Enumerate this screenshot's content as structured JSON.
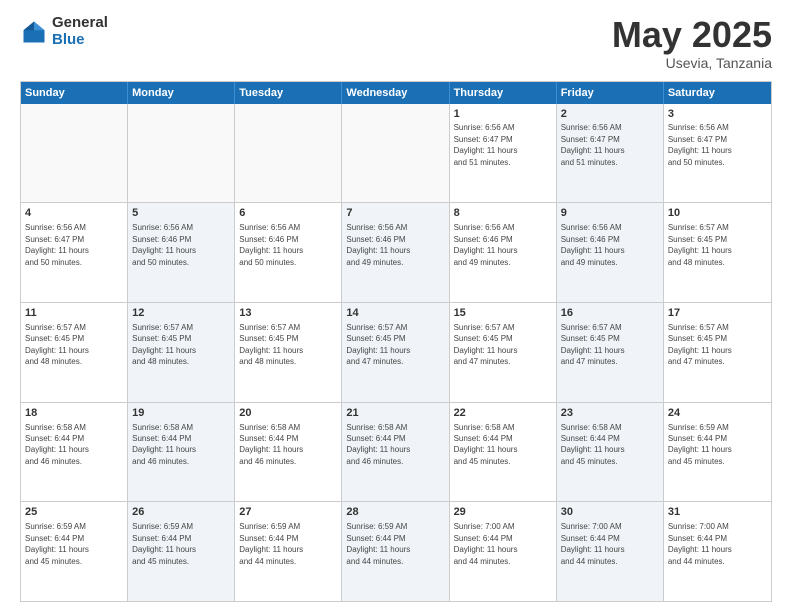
{
  "logo": {
    "general": "General",
    "blue": "Blue"
  },
  "header": {
    "month": "May 2025",
    "location": "Usevia, Tanzania"
  },
  "weekdays": [
    "Sunday",
    "Monday",
    "Tuesday",
    "Wednesday",
    "Thursday",
    "Friday",
    "Saturday"
  ],
  "rows": [
    [
      {
        "day": "",
        "info": "",
        "shaded": false,
        "empty": true
      },
      {
        "day": "",
        "info": "",
        "shaded": false,
        "empty": true
      },
      {
        "day": "",
        "info": "",
        "shaded": false,
        "empty": true
      },
      {
        "day": "",
        "info": "",
        "shaded": false,
        "empty": true
      },
      {
        "day": "1",
        "info": "Sunrise: 6:56 AM\nSunset: 6:47 PM\nDaylight: 11 hours\nand 51 minutes.",
        "shaded": false,
        "empty": false
      },
      {
        "day": "2",
        "info": "Sunrise: 6:56 AM\nSunset: 6:47 PM\nDaylight: 11 hours\nand 51 minutes.",
        "shaded": true,
        "empty": false
      },
      {
        "day": "3",
        "info": "Sunrise: 6:56 AM\nSunset: 6:47 PM\nDaylight: 11 hours\nand 50 minutes.",
        "shaded": false,
        "empty": false
      }
    ],
    [
      {
        "day": "4",
        "info": "Sunrise: 6:56 AM\nSunset: 6:47 PM\nDaylight: 11 hours\nand 50 minutes.",
        "shaded": false,
        "empty": false
      },
      {
        "day": "5",
        "info": "Sunrise: 6:56 AM\nSunset: 6:46 PM\nDaylight: 11 hours\nand 50 minutes.",
        "shaded": true,
        "empty": false
      },
      {
        "day": "6",
        "info": "Sunrise: 6:56 AM\nSunset: 6:46 PM\nDaylight: 11 hours\nand 50 minutes.",
        "shaded": false,
        "empty": false
      },
      {
        "day": "7",
        "info": "Sunrise: 6:56 AM\nSunset: 6:46 PM\nDaylight: 11 hours\nand 49 minutes.",
        "shaded": true,
        "empty": false
      },
      {
        "day": "8",
        "info": "Sunrise: 6:56 AM\nSunset: 6:46 PM\nDaylight: 11 hours\nand 49 minutes.",
        "shaded": false,
        "empty": false
      },
      {
        "day": "9",
        "info": "Sunrise: 6:56 AM\nSunset: 6:46 PM\nDaylight: 11 hours\nand 49 minutes.",
        "shaded": true,
        "empty": false
      },
      {
        "day": "10",
        "info": "Sunrise: 6:57 AM\nSunset: 6:45 PM\nDaylight: 11 hours\nand 48 minutes.",
        "shaded": false,
        "empty": false
      }
    ],
    [
      {
        "day": "11",
        "info": "Sunrise: 6:57 AM\nSunset: 6:45 PM\nDaylight: 11 hours\nand 48 minutes.",
        "shaded": false,
        "empty": false
      },
      {
        "day": "12",
        "info": "Sunrise: 6:57 AM\nSunset: 6:45 PM\nDaylight: 11 hours\nand 48 minutes.",
        "shaded": true,
        "empty": false
      },
      {
        "day": "13",
        "info": "Sunrise: 6:57 AM\nSunset: 6:45 PM\nDaylight: 11 hours\nand 48 minutes.",
        "shaded": false,
        "empty": false
      },
      {
        "day": "14",
        "info": "Sunrise: 6:57 AM\nSunset: 6:45 PM\nDaylight: 11 hours\nand 47 minutes.",
        "shaded": true,
        "empty": false
      },
      {
        "day": "15",
        "info": "Sunrise: 6:57 AM\nSunset: 6:45 PM\nDaylight: 11 hours\nand 47 minutes.",
        "shaded": false,
        "empty": false
      },
      {
        "day": "16",
        "info": "Sunrise: 6:57 AM\nSunset: 6:45 PM\nDaylight: 11 hours\nand 47 minutes.",
        "shaded": true,
        "empty": false
      },
      {
        "day": "17",
        "info": "Sunrise: 6:57 AM\nSunset: 6:45 PM\nDaylight: 11 hours\nand 47 minutes.",
        "shaded": false,
        "empty": false
      }
    ],
    [
      {
        "day": "18",
        "info": "Sunrise: 6:58 AM\nSunset: 6:44 PM\nDaylight: 11 hours\nand 46 minutes.",
        "shaded": false,
        "empty": false
      },
      {
        "day": "19",
        "info": "Sunrise: 6:58 AM\nSunset: 6:44 PM\nDaylight: 11 hours\nand 46 minutes.",
        "shaded": true,
        "empty": false
      },
      {
        "day": "20",
        "info": "Sunrise: 6:58 AM\nSunset: 6:44 PM\nDaylight: 11 hours\nand 46 minutes.",
        "shaded": false,
        "empty": false
      },
      {
        "day": "21",
        "info": "Sunrise: 6:58 AM\nSunset: 6:44 PM\nDaylight: 11 hours\nand 46 minutes.",
        "shaded": true,
        "empty": false
      },
      {
        "day": "22",
        "info": "Sunrise: 6:58 AM\nSunset: 6:44 PM\nDaylight: 11 hours\nand 45 minutes.",
        "shaded": false,
        "empty": false
      },
      {
        "day": "23",
        "info": "Sunrise: 6:58 AM\nSunset: 6:44 PM\nDaylight: 11 hours\nand 45 minutes.",
        "shaded": true,
        "empty": false
      },
      {
        "day": "24",
        "info": "Sunrise: 6:59 AM\nSunset: 6:44 PM\nDaylight: 11 hours\nand 45 minutes.",
        "shaded": false,
        "empty": false
      }
    ],
    [
      {
        "day": "25",
        "info": "Sunrise: 6:59 AM\nSunset: 6:44 PM\nDaylight: 11 hours\nand 45 minutes.",
        "shaded": false,
        "empty": false
      },
      {
        "day": "26",
        "info": "Sunrise: 6:59 AM\nSunset: 6:44 PM\nDaylight: 11 hours\nand 45 minutes.",
        "shaded": true,
        "empty": false
      },
      {
        "day": "27",
        "info": "Sunrise: 6:59 AM\nSunset: 6:44 PM\nDaylight: 11 hours\nand 44 minutes.",
        "shaded": false,
        "empty": false
      },
      {
        "day": "28",
        "info": "Sunrise: 6:59 AM\nSunset: 6:44 PM\nDaylight: 11 hours\nand 44 minutes.",
        "shaded": true,
        "empty": false
      },
      {
        "day": "29",
        "info": "Sunrise: 7:00 AM\nSunset: 6:44 PM\nDaylight: 11 hours\nand 44 minutes.",
        "shaded": false,
        "empty": false
      },
      {
        "day": "30",
        "info": "Sunrise: 7:00 AM\nSunset: 6:44 PM\nDaylight: 11 hours\nand 44 minutes.",
        "shaded": true,
        "empty": false
      },
      {
        "day": "31",
        "info": "Sunrise: 7:00 AM\nSunset: 6:44 PM\nDaylight: 11 hours\nand 44 minutes.",
        "shaded": false,
        "empty": false
      }
    ]
  ]
}
